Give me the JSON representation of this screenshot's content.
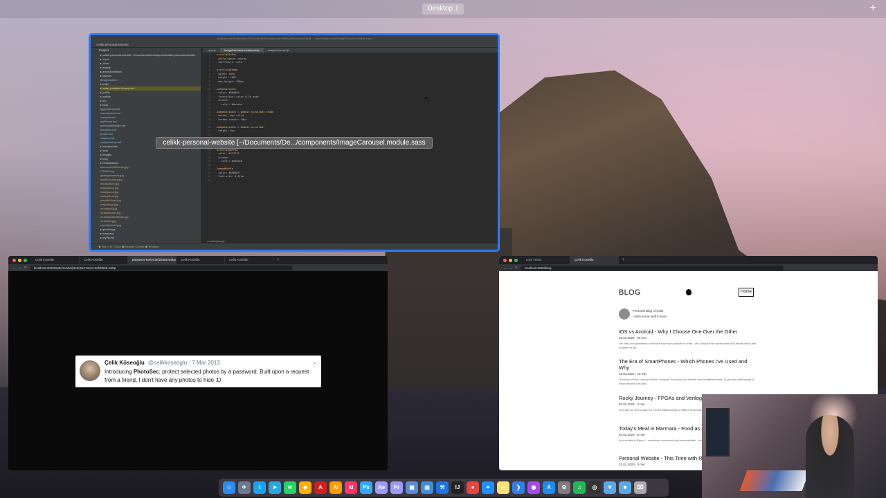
{
  "mission_control": {
    "desktop_label": "Desktop 1",
    "add_label": "+"
  },
  "ide": {
    "title": "celikk-personal-website [~/Documents/Development/celikk-personal-website] - .../src/components/ImageCarousel.module.sass",
    "project_name": "celikk-personal-website",
    "project_panel_label": "Project",
    "tabs": [
      "_app.js",
      "ImageCarousel.module.sass",
      "ImageCarousel.js"
    ],
    "tree": [
      {
        "label": "celikk-personal-website ~/Documents/Development/celikk-personal-website",
        "kind": "folder"
      },
      {
        "label": ".next",
        "kind": "folder"
      },
      {
        "label": ".idea",
        "kind": "folder"
      },
      {
        "label": "assets",
        "kind": "folder"
      },
      {
        "label": "arrowAnimation",
        "kind": "folder"
      },
      {
        "label": "favicon",
        "kind": "folder"
      },
      {
        "label": "design.sketch",
        "kind": "file"
      },
      {
        "label": "build",
        "kind": "folder"
      },
      {
        "label": "node_modules  library root",
        "kind": "hl"
      },
      {
        "label": "public",
        "kind": "folder"
      },
      {
        "label": "scripts",
        "kind": "folder"
      },
      {
        "label": "src",
        "kind": "folder"
      },
      {
        "label": "blog",
        "kind": "folder"
      },
      {
        "label": "fpgaJourney.md",
        "kind": "file"
      },
      {
        "label": "iosvsandroid.md",
        "kind": "file"
      },
      {
        "label": "marmara.md",
        "kind": "file"
      },
      {
        "label": "myPhone.md",
        "kind": "file"
      },
      {
        "label": "personalWebsite.md",
        "kind": "file"
      },
      {
        "label": "photosec.md",
        "kind": "file"
      },
      {
        "label": "prowe.md",
        "kind": "file"
      },
      {
        "label": "readme.md",
        "kind": "file"
      },
      {
        "label": "rockyJourney.md",
        "kind": "file"
      },
      {
        "label": "components",
        "kind": "folder"
      },
      {
        "label": "data",
        "kind": "folder"
      },
      {
        "label": "images",
        "kind": "folder"
      },
      {
        "label": "blog",
        "kind": "folder"
      },
      {
        "label": "CSNoteBook",
        "kind": "folder"
      },
      {
        "label": "awesomeOfBoards.jpg",
        "kind": "img"
      },
      {
        "label": "CS569.img",
        "kind": "img"
      },
      {
        "label": "gettingInterests.jpg",
        "kind": "img"
      },
      {
        "label": "hardFunctions.jpg",
        "kind": "img"
      },
      {
        "label": "introduction.jpg",
        "kind": "img"
      },
      {
        "label": "instagram1.jpg",
        "kind": "img"
      },
      {
        "label": "instagram2.jpg",
        "kind": "img"
      },
      {
        "label": "instagram3.jpg",
        "kind": "img"
      },
      {
        "label": "jumpBeGood.jpg",
        "kind": "img"
      },
      {
        "label": "makeApps.jpg",
        "kind": "img"
      },
      {
        "label": "monitorsIt.jpg",
        "kind": "img"
      },
      {
        "label": "musicBucket.jpg",
        "kind": "img"
      },
      {
        "label": "musicBucketAlbum.jpg",
        "kind": "img"
      },
      {
        "label": "musicbar.jpg",
        "kind": "img"
      },
      {
        "label": "usualAndroid.jpg",
        "kind": "img"
      },
      {
        "label": "iphoneage",
        "kind": "folder"
      },
      {
        "label": "marmara",
        "kind": "folder"
      },
      {
        "label": "myPhone",
        "kind": "folder"
      }
    ],
    "code": [
      {
        "n": "1",
        "t": ".scrollableDiv",
        "k": "sel"
      },
      {
        "n": "2",
        "t": "  white-space: nowrap",
        "k": "prop"
      },
      {
        "n": "3",
        "t": "  overflow-x: auto",
        "k": "prop"
      },
      {
        "n": "4",
        "t": "",
        "k": "prop"
      },
      {
        "n": "5",
        "t": ".scrollingImage",
        "k": "sel"
      },
      {
        "n": "6",
        "t": "  width: auto",
        "k": "prop"
      },
      {
        "n": "7",
        "t": "  height: 100%",
        "k": "prop"
      },
      {
        "n": "8",
        "t": "  max-height: 300px",
        "k": "prop"
      },
      {
        "n": "9",
        "t": "",
        "k": "prop"
      },
      {
        "n": "10",
        "t": ".imageCarousel",
        "k": "sel"
      },
      {
        "n": "11",
        "t": "  color: #000000",
        "k": "prop"
      },
      {
        "n": "12",
        "t": "  transition: color 0.3s ease",
        "k": "prop"
      },
      {
        "n": "13",
        "t": "  &:hover",
        "k": "prop"
      },
      {
        "n": "14",
        "t": "    color: #bcbcbc",
        "k": "prop"
      },
      {
        "n": "15",
        "t": "",
        "k": "prop"
      },
      {
        "n": "16",
        "t": ".imageCarousel::-webkit-scrollbar-thumb",
        "k": "sel"
      },
      {
        "n": "17",
        "t": "  border: 0px solid",
        "k": "prop"
      },
      {
        "n": "18",
        "t": "  border-radius: 10px",
        "k": "prop"
      },
      {
        "n": "19",
        "t": "",
        "k": "prop"
      },
      {
        "n": "20",
        "t": ".imageCarousel::-webkit-scrollbar",
        "k": "sel"
      },
      {
        "n": "21",
        "t": "  height: 0px",
        "k": "prop"
      },
      {
        "n": "22",
        "t": "",
        "k": "prop"
      },
      {
        "n": "23",
        "t": "",
        "k": "prop"
      },
      {
        "n": "24",
        "t": "",
        "k": "prop"
      },
      {
        "n": "25",
        "t": "",
        "k": "prop"
      },
      {
        "n": "26",
        "t": ".scrollingArrow",
        "k": "sel"
      },
      {
        "n": "27",
        "t": "  color: #727272",
        "k": "prop"
      },
      {
        "n": "28",
        "t": "  &:hover",
        "k": "prop"
      },
      {
        "n": "29",
        "t": "    color: #ebebeb",
        "k": "prop"
      },
      {
        "n": "30",
        "t": "",
        "k": "prop"
      },
      {
        "n": "31",
        "t": ".imageMiddle",
        "k": "sel"
      },
      {
        "n": "32",
        "t": "  color: #696969",
        "k": "prop"
      },
      {
        "n": "33",
        "t": "  font-size: 0.6rem",
        "k": "prop"
      },
      {
        "n": "34",
        "t": "",
        "k": "prop"
      }
    ],
    "status_left": "▶ Run   ≡ 6: TODO   ▣ Version Control   ▣ Terminal",
    "breadcrumb_bottom": "scrollingImage",
    "tooltip": "celikk-personal-website [~/Documents/De.../components/ImageCarousel.module.sass"
  },
  "browser_left": {
    "tabs": [
      "Çelik Köseðlu",
      "Çelik Köseðlu",
      "photoSecTweet.9ef2b565.webp",
      "Çelik Köseðlu",
      "Çelik Köseðlu"
    ],
    "active_tab": 2,
    "url": "localhost:3000/static/media/photoSecTweet.9ef2b565.webp",
    "tweet": {
      "name": "Çelik Köseoğlu",
      "handle": "@celikkoseoglu · 7 Mar 2013",
      "text_before": "Introducing ",
      "text_bold": "PhotoSec",
      "text_after": "; protect selected photos by a password. Built upon a request from a friend, I don't have any photos to hide :D"
    }
  },
  "browser_right": {
    "tabs": [
      "CSS Tricks",
      "Çelik Köseðlu"
    ],
    "url": "localhost:3000/blog",
    "blog_title": "BLOG",
    "home_label": "Home",
    "subtitle1": "Personal Blog of Çelik",
    "subtitle2": "I write some stuff in here",
    "posts": [
      {
        "title": "iOS vs Android - Why I Choose One Over the Other",
        "date": "15.03.2020 - 20 min",
        "excerpt": "I've used one generation of devices from each platform in order. Let's compare the current state and decide which one is better for me."
      },
      {
        "title": "The Era of SmartPhones - Which Phones I've Used and Why",
        "date": "01.03.2020 - 15 min",
        "excerpt": "The story of how I was an iPhone, Windows Phone and an Android user at different times. I'll give you brief history of which devices I've used."
      },
      {
        "title": "Rocky Journey - FPGAs and Verilog",
        "date": "02.02.2020 - 4 min",
        "excerpt": "This was our term project for CS223 Digital Design in Bilkent University. Flappy Bird using an 8x8 LED Matrix."
      },
      {
        "title": "Today's Meal in Marmara - Food as N...",
        "date": "02.02.2020 - 5 min",
        "excerpt": "As a student in Bilkent, I sometimes wondered what was available... should be an app for this."
      },
      {
        "title": "Personal Website - This Time with Re...",
        "date": "31.01.2020 - 3 min",
        "excerpt": ""
      }
    ]
  },
  "dock": {
    "icons": [
      {
        "name": "finder-icon",
        "color": "#2a8bf2",
        "glyph": "☺"
      },
      {
        "name": "launchpad-icon",
        "color": "#6c7a8c",
        "glyph": "✈"
      },
      {
        "name": "twitter-icon",
        "color": "#1da1f2",
        "glyph": "t"
      },
      {
        "name": "telegram-icon",
        "color": "#2ca5e0",
        "glyph": "➤"
      },
      {
        "name": "whatsapp-icon",
        "color": "#25d366",
        "glyph": "w"
      },
      {
        "name": "sketch-icon",
        "color": "#fdad00",
        "glyph": "◆"
      },
      {
        "name": "acrobat-icon",
        "color": "#cf1f20",
        "glyph": "A"
      },
      {
        "name": "illustrator-icon",
        "color": "#ff9a00",
        "glyph": "Ai"
      },
      {
        "name": "indesign-icon",
        "color": "#ff3366",
        "glyph": "Id"
      },
      {
        "name": "photoshop-icon",
        "color": "#31a8ff",
        "glyph": "Ps"
      },
      {
        "name": "after-effects-icon",
        "color": "#9999ff",
        "glyph": "Ae"
      },
      {
        "name": "premiere-icon",
        "color": "#9999ff",
        "glyph": "Pr"
      },
      {
        "name": "preview-icon",
        "color": "#5a8bd6",
        "glyph": "▣"
      },
      {
        "name": "files-icon",
        "color": "#3d8fdb",
        "glyph": "▤"
      },
      {
        "name": "xcode-icon",
        "color": "#1a74e8",
        "glyph": "⚒"
      },
      {
        "name": "intellij-icon",
        "color": "#222",
        "glyph": "IJ"
      },
      {
        "name": "chrome-icon",
        "color": "#e9453a",
        "glyph": "●"
      },
      {
        "name": "safari-icon",
        "color": "#1e90ff",
        "glyph": "⌖"
      },
      {
        "name": "notes-icon",
        "color": "#f7e27a",
        "glyph": "≡"
      },
      {
        "name": "vscode-icon",
        "color": "#2f80ed",
        "glyph": "❯"
      },
      {
        "name": "podcasts-icon",
        "color": "#a44ce5",
        "glyph": "◉"
      },
      {
        "name": "appstore-icon",
        "color": "#1c8cf2",
        "glyph": "A"
      },
      {
        "name": "system-prefs-icon",
        "color": "#7e7e7e",
        "glyph": "⚙"
      },
      {
        "name": "spotify-icon",
        "color": "#1db954",
        "glyph": "♫"
      },
      {
        "name": "obs-icon",
        "color": "#333",
        "glyph": "◎"
      },
      {
        "name": "downloads-folder-icon",
        "color": "#5aa9e6",
        "glyph": "▼"
      },
      {
        "name": "documents-folder-icon",
        "color": "#5aa9e6",
        "glyph": "■"
      },
      {
        "name": "trash-icon",
        "color": "#aaaaaa",
        "glyph": "⌧"
      }
    ]
  }
}
